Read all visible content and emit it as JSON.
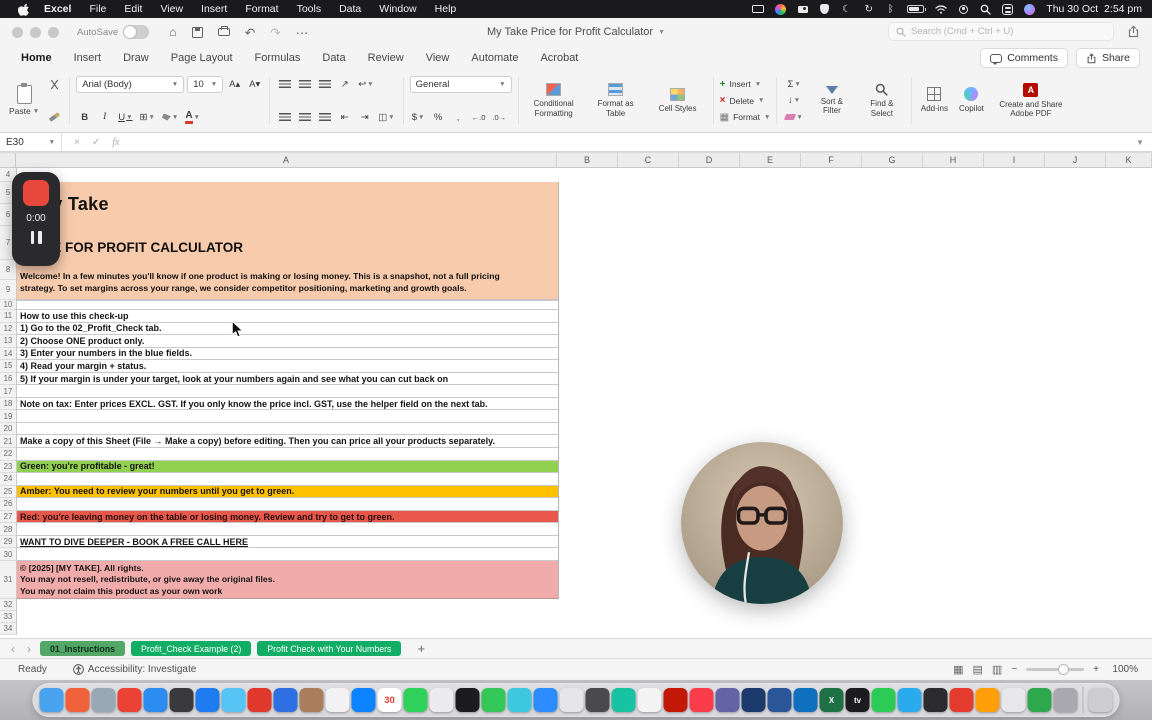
{
  "menubar": {
    "app_name": "Excel",
    "menus": [
      "File",
      "Edit",
      "View",
      "Insert",
      "Format",
      "Tools",
      "Data",
      "Window",
      "Help"
    ],
    "clock": "Thu 30 Oct  2:54 pm"
  },
  "titlebar": {
    "autosave_label": "AutoSave",
    "doc_title": "My Take Price for Profit Calculator",
    "search_placeholder": "Search (Cmd + Ctrl + U)"
  },
  "ribbon": {
    "tabs": [
      {
        "label": "Home",
        "active": true
      },
      {
        "label": "Insert"
      },
      {
        "label": "Draw"
      },
      {
        "label": "Page Layout"
      },
      {
        "label": "Formulas"
      },
      {
        "label": "Data"
      },
      {
        "label": "Review"
      },
      {
        "label": "View"
      },
      {
        "label": "Automate"
      },
      {
        "label": "Acrobat"
      }
    ],
    "comments_label": "Comments",
    "share_label": "Share",
    "paste_label": "Paste",
    "font_name": "Arial (Body)",
    "font_size": "10",
    "number_format": "General",
    "glyphs": {
      "bold": "B",
      "italic": "I",
      "underline": "U",
      "sum": "Σ",
      "currency": "$",
      "percent": "%",
      "comma": ","
    },
    "conditional_label": "Conditional Formatting",
    "format_table_label": "Format as Table",
    "cell_styles_label": "Cell Styles",
    "insert_label": "Insert",
    "delete_label": "Delete",
    "format_label": "Format",
    "sort_filter_label": "Sort & Filter",
    "find_select_label": "Find & Select",
    "addins_label": "Add-ins",
    "copilot_label": "Copilot",
    "adobe_label": "Create and Share Adobe PDF"
  },
  "formula_bar": {
    "name_box": "E30",
    "fx_label": "fx"
  },
  "grid": {
    "columns": [
      "A",
      "B",
      "C",
      "D",
      "E",
      "F",
      "G",
      "H",
      "I",
      "J",
      "K"
    ],
    "row_start": 4,
    "row_end": 34
  },
  "sheet": {
    "logo_text": "My Take",
    "title": "PRICE FOR PROFIT CALCULATOR",
    "welcome_line1": "Welcome! In a few minutes you'll know if one product is making or losing money. This is a snapshot, not a full pricing",
    "welcome_line2": "strategy. To set margins across your range, we consider competitor positioning, marketing and growth goals.",
    "rows": [
      {
        "n": 10,
        "text": ""
      },
      {
        "n": 11,
        "text": "How to use this check-up"
      },
      {
        "n": 12,
        "text": "1) Go to the 02_Profit_Check tab."
      },
      {
        "n": 13,
        "text": "2) Choose ONE product only."
      },
      {
        "n": 14,
        "text": "3) Enter your numbers in the blue fields."
      },
      {
        "n": 15,
        "text": "4) Read your margin + status."
      },
      {
        "n": 16,
        "text": "5) If your margin is under your target, look at your numbers again and see what you can cut back on"
      },
      {
        "n": 17,
        "text": ""
      },
      {
        "n": 18,
        "text": "Note on tax: Enter prices EXCL. GST. If you only know the price incl. GST, use the helper field on the next tab."
      },
      {
        "n": 19,
        "text": ""
      },
      {
        "n": 20,
        "text": ""
      },
      {
        "n": 21,
        "text": "Make a copy of this Sheet (File → Make a copy) before editing. Then you can price all your products separately."
      },
      {
        "n": 22,
        "text": ""
      },
      {
        "n": 23,
        "text": "Green: you're profitable - great!",
        "bg": "green"
      },
      {
        "n": 24,
        "text": ""
      },
      {
        "n": 25,
        "text": "Amber:  You need to review your numbers until you get to green.",
        "bg": "amber"
      },
      {
        "n": 26,
        "text": ""
      },
      {
        "n": 27,
        "text": "Red: you're leaving money on the table or losing money. Review and try to get to green.",
        "bg": "red"
      },
      {
        "n": 28,
        "text": ""
      },
      {
        "n": 29,
        "text": "WANT TO DIVE DEEPER - BOOK A FREE CALL HERE",
        "underline": true
      },
      {
        "n": 30,
        "text": ""
      }
    ],
    "copyright_lines": [
      "© [2025] [MY TAKE]. All rights.",
      "You may not resell, redistribute, or give away the original files.",
      "You may not claim this product as your own work"
    ],
    "colors": {
      "header_peach": "#F8CBAD",
      "green": "#92D050",
      "amber": "#FFC000",
      "red": "#E8574B",
      "copyright_pink": "#F2ABAB"
    }
  },
  "tabs_bar": {
    "tabs": [
      {
        "label": "01_Instructions",
        "active": true
      },
      {
        "label": "Profit_Check Example (2)"
      },
      {
        "label": "Profit Check with Your Numbers"
      }
    ],
    "add_label": "+",
    "tab_color": "#12AD64",
    "active_tab_color": "#53A766"
  },
  "status_bar": {
    "ready_label": "Ready",
    "accessibility_label": "Accessibility: Investigate",
    "zoom_value": "100%"
  },
  "recorder": {
    "time": "0:00"
  },
  "dock": {
    "apps": [
      {
        "name": "finder",
        "color": "#4AA3EE"
      },
      {
        "name": "app-orange-red",
        "color": "#F0613C"
      },
      {
        "name": "app-slate",
        "color": "#9AA7B4"
      },
      {
        "name": "app-multicolor",
        "color": "#EA4335"
      },
      {
        "name": "app-compass-blue",
        "color": "#2D8CF0"
      },
      {
        "name": "app-darkgray",
        "color": "#3A3A3C"
      },
      {
        "name": "app-blue",
        "color": "#1E7BF0"
      },
      {
        "name": "app-skyblue",
        "color": "#56C4F5"
      },
      {
        "name": "app-red",
        "color": "#E0382B"
      },
      {
        "name": "app-royalblue",
        "color": "#2F6FE4"
      },
      {
        "name": "app-brown",
        "color": "#A97E5D"
      },
      {
        "name": "app-white-flower",
        "color": "#F2F2F4"
      },
      {
        "name": "app-blue-2",
        "color": "#0D84FF"
      },
      {
        "name": "calendar",
        "color": "#FFFFFF",
        "glyph": "30"
      },
      {
        "name": "app-green",
        "color": "#2FD15B"
      },
      {
        "name": "app-offwhite",
        "color": "#ECECEE"
      },
      {
        "name": "app-black",
        "color": "#1C1C1E"
      },
      {
        "name": "app-green-2",
        "color": "#33C758"
      },
      {
        "name": "app-cyan",
        "color": "#3EC8DF"
      },
      {
        "name": "app-blue-3",
        "color": "#2D8CFF"
      },
      {
        "name": "app-lightgray",
        "color": "#E6E6EA"
      },
      {
        "name": "app-charcoal",
        "color": "#4A4A4E"
      },
      {
        "name": "app-teal",
        "color": "#17C3A2"
      },
      {
        "name": "app-white-2",
        "color": "#F4F4F4"
      },
      {
        "name": "acrobat",
        "color": "#C21807"
      },
      {
        "name": "app-crimson",
        "color": "#FA3C4C"
      },
      {
        "name": "app-purple",
        "color": "#6264A7"
      },
      {
        "name": "app-navy",
        "color": "#1C3B6C"
      },
      {
        "name": "app-word-blue",
        "color": "#2B579A"
      },
      {
        "name": "app-outlook-blue",
        "color": "#1070C0"
      },
      {
        "name": "excel",
        "color": "#1E7145",
        "glyph": "X"
      },
      {
        "name": "apple-tv",
        "color": "#1C1C1E",
        "glyph": "tv"
      },
      {
        "name": "app-green-3",
        "color": "#2BCB55"
      },
      {
        "name": "app-lightblue-2",
        "color": "#2AABEE"
      },
      {
        "name": "app-black-2",
        "color": "#2C2C2E"
      },
      {
        "name": "app-red-2",
        "color": "#E33B2E"
      },
      {
        "name": "app-amber",
        "color": "#FF9F0A"
      },
      {
        "name": "app-white-3",
        "color": "#E8E8EC"
      },
      {
        "name": "app-green-4",
        "color": "#2EA84F"
      },
      {
        "name": "settings-gear",
        "color": "#A8A8AE"
      },
      {
        "name": "trash",
        "color": "#CDCDD2"
      }
    ]
  }
}
